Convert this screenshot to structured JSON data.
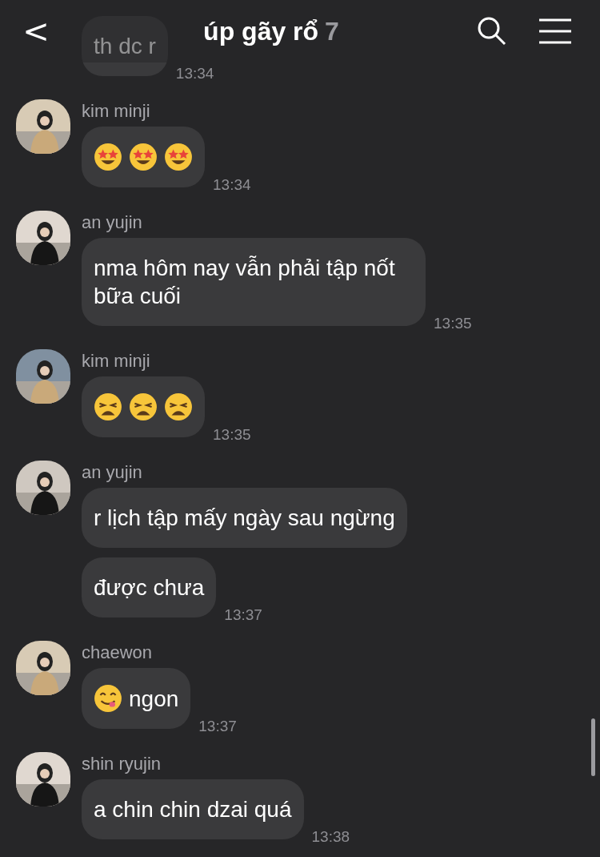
{
  "header": {
    "back": "<",
    "title": "úp gãy rổ",
    "member_count": "7"
  },
  "messages": [
    {
      "bubbles": [
        {
          "parts": [
            {
              "kind": "text",
              "text": "th dc r"
            }
          ],
          "time": "13:34"
        }
      ]
    },
    {
      "sender": "kim minji",
      "bubbles": [
        {
          "parts": [
            {
              "kind": "star-struck-emoji"
            },
            {
              "kind": "star-struck-emoji"
            },
            {
              "kind": "star-struck-emoji"
            }
          ],
          "time": "13:34"
        }
      ]
    },
    {
      "sender": "an yujin",
      "bubbles": [
        {
          "parts": [
            {
              "kind": "text",
              "text": "nma hôm nay vẫn phải tập nốt bữa cuối"
            }
          ],
          "time": "13:35"
        }
      ]
    },
    {
      "sender": "kim minji",
      "bubbles": [
        {
          "parts": [
            {
              "kind": "weary-emoji"
            },
            {
              "kind": "weary-emoji"
            },
            {
              "kind": "weary-emoji"
            }
          ],
          "time": "13:35"
        }
      ]
    },
    {
      "sender": "an yujin",
      "bubbles": [
        {
          "parts": [
            {
              "kind": "text",
              "text": "r lịch tập mấy ngày sau ngừng"
            }
          ]
        },
        {
          "parts": [
            {
              "kind": "text",
              "text": "được chưa"
            }
          ],
          "time": "13:37"
        }
      ]
    },
    {
      "sender": "chaewon",
      "bubbles": [
        {
          "parts": [
            {
              "kind": "yum-emoji"
            },
            {
              "kind": "text",
              "text": "ngon"
            }
          ],
          "time": "13:37"
        }
      ]
    },
    {
      "sender": "shin ryujin",
      "bubbles": [
        {
          "parts": [
            {
              "kind": "text",
              "text": "a chin chin dzai quá"
            }
          ],
          "time": "13:38"
        }
      ]
    }
  ]
}
